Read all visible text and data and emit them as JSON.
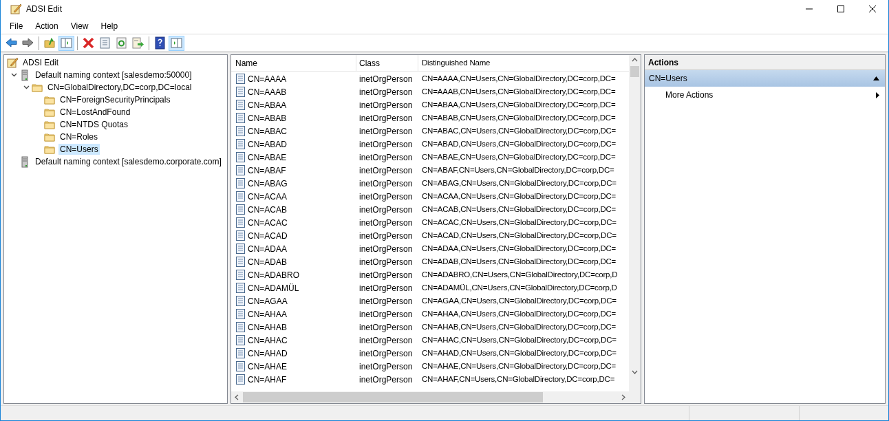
{
  "window": {
    "title": "ADSI Edit"
  },
  "menu": [
    "File",
    "Action",
    "View",
    "Help"
  ],
  "toolbar": [
    {
      "kind": "back",
      "pressed": false
    },
    {
      "kind": "forward",
      "pressed": false
    },
    {
      "kind": "sep"
    },
    {
      "kind": "up",
      "pressed": false
    },
    {
      "kind": "tree",
      "pressed": true
    },
    {
      "kind": "sep"
    },
    {
      "kind": "delete",
      "pressed": false
    },
    {
      "kind": "properties",
      "pressed": false
    },
    {
      "kind": "refresh",
      "pressed": false
    },
    {
      "kind": "export",
      "pressed": false
    },
    {
      "kind": "sep"
    },
    {
      "kind": "help",
      "pressed": false
    },
    {
      "kind": "pane",
      "pressed": true
    }
  ],
  "tree": [
    {
      "label": "ADSI Edit",
      "kind": "app",
      "selected": false,
      "children": [
        {
          "label": "Default naming context [salesdemo:50000]",
          "kind": "server",
          "expanded": true,
          "selected": false,
          "children": [
            {
              "label": "CN=GlobalDirectory,DC=corp,DC=local",
              "kind": "folder",
              "expanded": true,
              "selected": false,
              "children": [
                {
                  "label": "CN=ForeignSecurityPrincipals",
                  "kind": "folder",
                  "selected": false
                },
                {
                  "label": "CN=LostAndFound",
                  "kind": "folder",
                  "selected": false
                },
                {
                  "label": "CN=NTDS Quotas",
                  "kind": "folder",
                  "selected": false
                },
                {
                  "label": "CN=Roles",
                  "kind": "folder",
                  "selected": false
                },
                {
                  "label": "CN=Users",
                  "kind": "folder",
                  "selected": true
                }
              ]
            }
          ]
        },
        {
          "label": "Default naming context [salesdemo.corporate.com]",
          "kind": "server",
          "selected": false
        }
      ]
    }
  ],
  "table": {
    "columns": [
      "Name",
      "Class",
      "Distinguished Name"
    ],
    "rows": [
      [
        "CN=AAAA",
        "inetOrgPerson",
        "CN=AAAA,CN=Users,CN=GlobalDirectory,DC=corp,DC="
      ],
      [
        "CN=AAAB",
        "inetOrgPerson",
        "CN=AAAB,CN=Users,CN=GlobalDirectory,DC=corp,DC="
      ],
      [
        "CN=ABAA",
        "inetOrgPerson",
        "CN=ABAA,CN=Users,CN=GlobalDirectory,DC=corp,DC="
      ],
      [
        "CN=ABAB",
        "inetOrgPerson",
        "CN=ABAB,CN=Users,CN=GlobalDirectory,DC=corp,DC="
      ],
      [
        "CN=ABAC",
        "inetOrgPerson",
        "CN=ABAC,CN=Users,CN=GlobalDirectory,DC=corp,DC="
      ],
      [
        "CN=ABAD",
        "inetOrgPerson",
        "CN=ABAD,CN=Users,CN=GlobalDirectory,DC=corp,DC="
      ],
      [
        "CN=ABAE",
        "inetOrgPerson",
        "CN=ABAE,CN=Users,CN=GlobalDirectory,DC=corp,DC="
      ],
      [
        "CN=ABAF",
        "inetOrgPerson",
        "CN=ABAF,CN=Users,CN=GlobalDirectory,DC=corp,DC="
      ],
      [
        "CN=ABAG",
        "inetOrgPerson",
        "CN=ABAG,CN=Users,CN=GlobalDirectory,DC=corp,DC="
      ],
      [
        "CN=ACAA",
        "inetOrgPerson",
        "CN=ACAA,CN=Users,CN=GlobalDirectory,DC=corp,DC="
      ],
      [
        "CN=ACAB",
        "inetOrgPerson",
        "CN=ACAB,CN=Users,CN=GlobalDirectory,DC=corp,DC="
      ],
      [
        "CN=ACAC",
        "inetOrgPerson",
        "CN=ACAC,CN=Users,CN=GlobalDirectory,DC=corp,DC="
      ],
      [
        "CN=ACAD",
        "inetOrgPerson",
        "CN=ACAD,CN=Users,CN=GlobalDirectory,DC=corp,DC="
      ],
      [
        "CN=ADAA",
        "inetOrgPerson",
        "CN=ADAA,CN=Users,CN=GlobalDirectory,DC=corp,DC="
      ],
      [
        "CN=ADAB",
        "inetOrgPerson",
        "CN=ADAB,CN=Users,CN=GlobalDirectory,DC=corp,DC="
      ],
      [
        "CN=ADABRO",
        "inetOrgPerson",
        "CN=ADABRO,CN=Users,CN=GlobalDirectory,DC=corp,D"
      ],
      [
        "CN=ADAMÜL",
        "inetOrgPerson",
        "CN=ADAMÜL,CN=Users,CN=GlobalDirectory,DC=corp,D"
      ],
      [
        "CN=AGAA",
        "inetOrgPerson",
        "CN=AGAA,CN=Users,CN=GlobalDirectory,DC=corp,DC="
      ],
      [
        "CN=AHAA",
        "inetOrgPerson",
        "CN=AHAA,CN=Users,CN=GlobalDirectory,DC=corp,DC="
      ],
      [
        "CN=AHAB",
        "inetOrgPerson",
        "CN=AHAB,CN=Users,CN=GlobalDirectory,DC=corp,DC="
      ],
      [
        "CN=AHAC",
        "inetOrgPerson",
        "CN=AHAC,CN=Users,CN=GlobalDirectory,DC=corp,DC="
      ],
      [
        "CN=AHAD",
        "inetOrgPerson",
        "CN=AHAD,CN=Users,CN=GlobalDirectory,DC=corp,DC="
      ],
      [
        "CN=AHAE",
        "inetOrgPerson",
        "CN=AHAE,CN=Users,CN=GlobalDirectory,DC=corp,DC="
      ],
      [
        "CN=AHAF",
        "inetOrgPerson",
        "CN=AHAF,CN=Users,CN=GlobalDirectory,DC=corp,DC="
      ]
    ]
  },
  "actions": {
    "title": "Actions",
    "sections": [
      {
        "label": "CN=Users",
        "expanded": true,
        "items": [
          {
            "label": "More Actions",
            "submenu": true
          }
        ]
      }
    ]
  }
}
